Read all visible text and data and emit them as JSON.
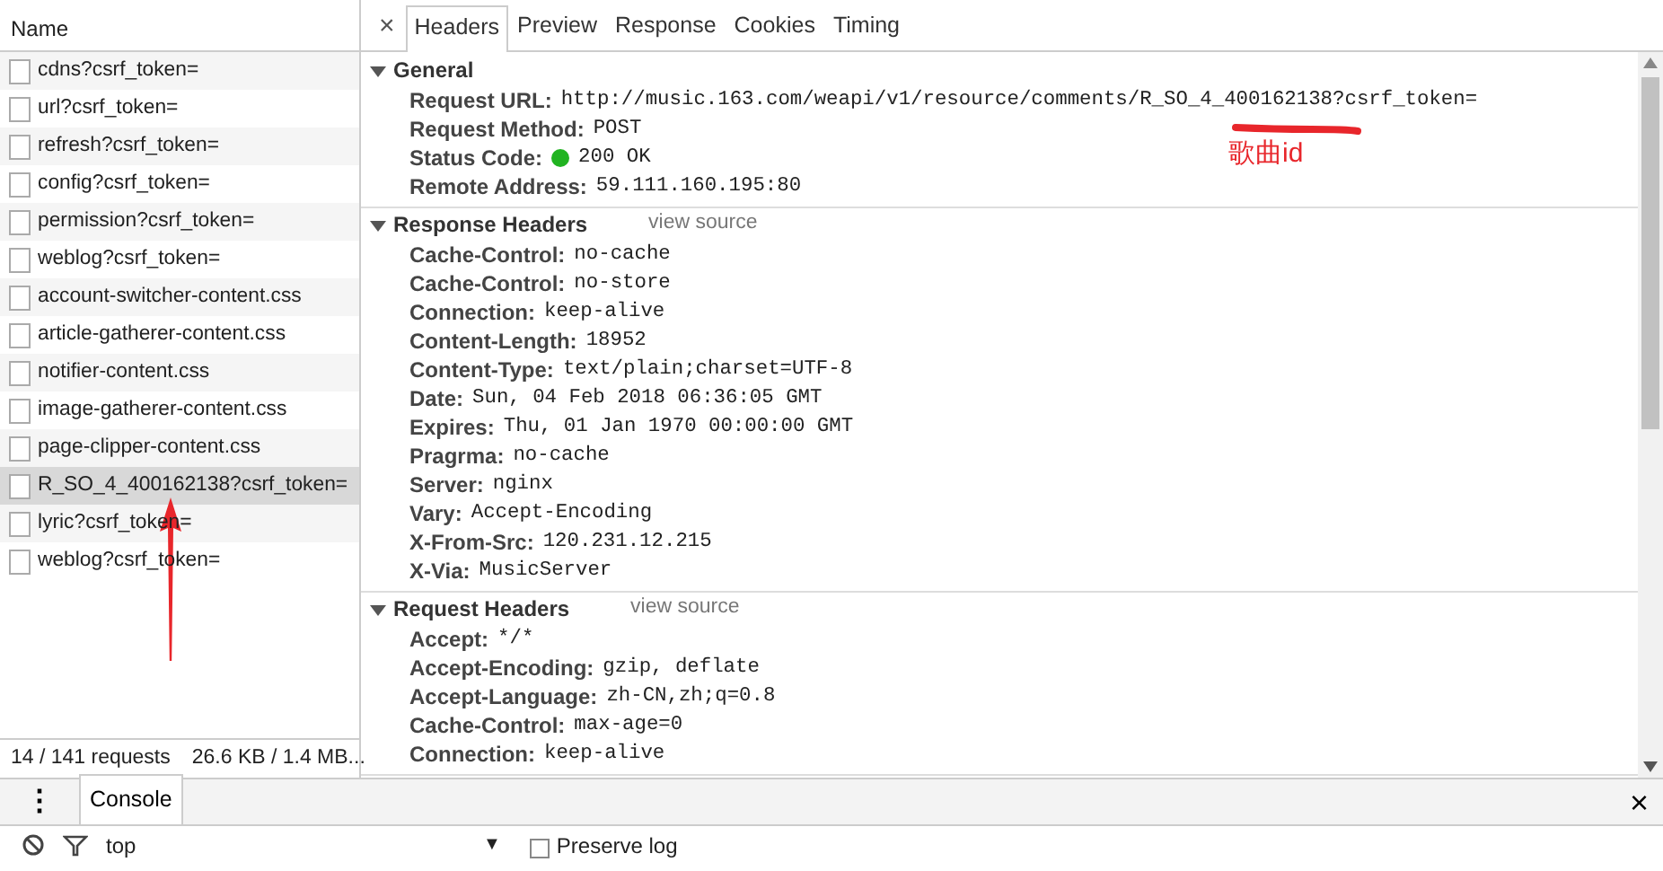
{
  "network_list": {
    "column_header": "Name",
    "rows": [
      {
        "name": "cdns?csrf_token=",
        "selected": false
      },
      {
        "name": "url?csrf_token=",
        "selected": false
      },
      {
        "name": "refresh?csrf_token=",
        "selected": false
      },
      {
        "name": "config?csrf_token=",
        "selected": false
      },
      {
        "name": "permission?csrf_token=",
        "selected": false
      },
      {
        "name": "weblog?csrf_token=",
        "selected": false
      },
      {
        "name": "account-switcher-content.css",
        "selected": false
      },
      {
        "name": "article-gatherer-content.css",
        "selected": false
      },
      {
        "name": "notifier-content.css",
        "selected": false
      },
      {
        "name": "image-gatherer-content.css",
        "selected": false
      },
      {
        "name": "page-clipper-content.css",
        "selected": false
      },
      {
        "name": "R_SO_4_400162138?csrf_token=",
        "selected": true
      },
      {
        "name": "lyric?csrf_token=",
        "selected": false
      },
      {
        "name": "weblog?csrf_token=",
        "selected": false
      }
    ],
    "status": {
      "requests": "14 / 141 requests",
      "transfer": "26.6 KB / 1.4 MB..."
    }
  },
  "details": {
    "close": "×",
    "tabs": [
      {
        "label": "Headers",
        "selected": true
      },
      {
        "label": "Preview",
        "selected": false
      },
      {
        "label": "Response",
        "selected": false
      },
      {
        "label": "Cookies",
        "selected": false
      },
      {
        "label": "Timing",
        "selected": false
      }
    ],
    "sections": [
      {
        "title": "General",
        "expanded": true,
        "fields": [
          {
            "key": "Request URL:",
            "value": "http://music.163.com/weapi/v1/resource/comments/R_SO_4_400162138?csrf_token=",
            "kind": "text"
          },
          {
            "key": "Request Method:",
            "value": "POST",
            "kind": "text"
          },
          {
            "key": "Status Code:",
            "value": "200 OK",
            "kind": "status"
          },
          {
            "key": "Remote Address:",
            "value": "59.111.160.195:80",
            "kind": "text"
          }
        ]
      },
      {
        "title": "Response Headers",
        "expanded": true,
        "link": "view source",
        "fields": [
          {
            "key": "Cache-Control:",
            "value": "no-cache",
            "kind": "text"
          },
          {
            "key": "Cache-Control:",
            "value": "no-store",
            "kind": "text"
          },
          {
            "key": "Connection:",
            "value": "keep-alive",
            "kind": "text"
          },
          {
            "key": "Content-Length:",
            "value": "18952",
            "kind": "text"
          },
          {
            "key": "Content-Type:",
            "value": "text/plain;charset=UTF-8",
            "kind": "text"
          },
          {
            "key": "Date:",
            "value": "Sun, 04 Feb 2018 06:36:05 GMT",
            "kind": "text"
          },
          {
            "key": "Expires:",
            "value": "Thu, 01 Jan 1970 00:00:00 GMT",
            "kind": "text"
          },
          {
            "key": "Pragrma:",
            "value": "no-cache",
            "kind": "text"
          },
          {
            "key": "Server:",
            "value": "nginx",
            "kind": "text"
          },
          {
            "key": "Vary:",
            "value": "Accept-Encoding",
            "kind": "text"
          },
          {
            "key": "X-From-Src:",
            "value": "120.231.12.215",
            "kind": "text"
          },
          {
            "key": "X-Via:",
            "value": "MusicServer",
            "kind": "text"
          }
        ]
      },
      {
        "title": "Request Headers",
        "expanded": true,
        "link": "view source",
        "fields": [
          {
            "key": "Accept:",
            "value": "*/*",
            "kind": "text"
          },
          {
            "key": "Accept-Encoding:",
            "value": "gzip, deflate",
            "kind": "text"
          },
          {
            "key": "Accept-Language:",
            "value": "zh-CN,zh;q=0.8",
            "kind": "text"
          },
          {
            "key": "Cache-Control:",
            "value": "max-age=0",
            "kind": "text"
          },
          {
            "key": "Connection:",
            "value": "keep-alive",
            "kind": "text"
          }
        ]
      }
    ]
  },
  "annotation": {
    "note": "歌曲id"
  },
  "drawer": {
    "menu": "⋮",
    "tab": "Console",
    "close": "×"
  },
  "console_toolbar": {
    "context": "top",
    "dropdown": "▼",
    "preserve_log": {
      "label": "Preserve log",
      "checked": false
    }
  }
}
